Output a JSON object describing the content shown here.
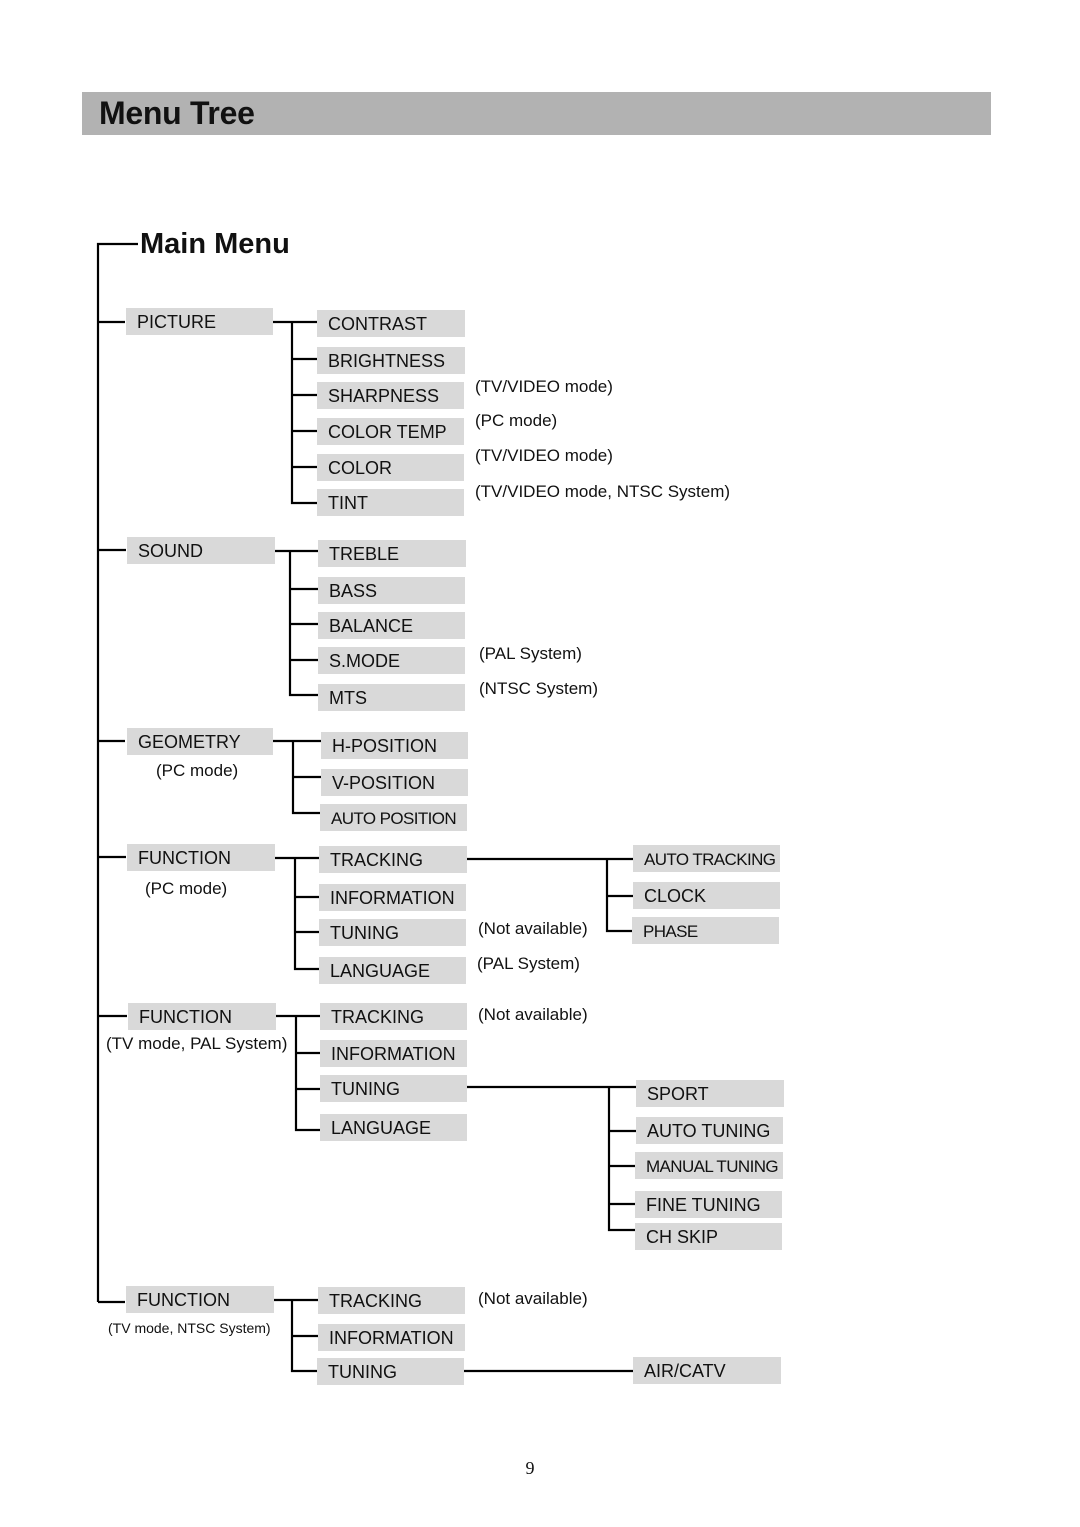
{
  "header": {
    "title": "Menu Tree"
  },
  "tree": {
    "title": "Main Menu",
    "groups": [
      {
        "label": "PICTURE",
        "note": "",
        "items": [
          {
            "label": "CONTRAST",
            "note": ""
          },
          {
            "label": "BRIGHTNESS",
            "note": ""
          },
          {
            "label": "SHARPNESS",
            "note": "(TV/VIDEO mode)"
          },
          {
            "label": "COLOR TEMP",
            "note": "(PC mode)"
          },
          {
            "label": "COLOR",
            "note": "(TV/VIDEO mode)"
          },
          {
            "label": "TINT",
            "note": "(TV/VIDEO mode, NTSC System)"
          }
        ]
      },
      {
        "label": "SOUND",
        "note": "",
        "items": [
          {
            "label": "TREBLE",
            "note": ""
          },
          {
            "label": "BASS",
            "note": ""
          },
          {
            "label": "BALANCE",
            "note": ""
          },
          {
            "label": "S.MODE",
            "note": "(PAL System)"
          },
          {
            "label": "MTS",
            "note": "(NTSC System)"
          }
        ]
      },
      {
        "label": "GEOMETRY",
        "note": "(PC mode)",
        "items": [
          {
            "label": "H-POSITION",
            "note": ""
          },
          {
            "label": "V-POSITION",
            "note": ""
          },
          {
            "label": "AUTO POSITION",
            "note": ""
          }
        ]
      },
      {
        "label": "FUNCTION",
        "note": "(PC mode)",
        "items": [
          {
            "label": "TRACKING",
            "note": "",
            "children": [
              "AUTO TRACKING",
              "CLOCK",
              "PHASE"
            ]
          },
          {
            "label": "INFORMATION",
            "note": ""
          },
          {
            "label": "TUNING",
            "note": "(Not available)"
          },
          {
            "label": "LANGUAGE",
            "note": "(PAL System)"
          }
        ]
      },
      {
        "label": "FUNCTION",
        "note": "(TV mode, PAL System)",
        "items": [
          {
            "label": "TRACKING",
            "note": "(Not available)"
          },
          {
            "label": "INFORMATION",
            "note": ""
          },
          {
            "label": "TUNING",
            "note": "",
            "children": [
              "SPORT",
              "AUTO TUNING",
              "MANUAL TUNING",
              "FINE TUNING",
              "CH SKIP"
            ]
          },
          {
            "label": "LANGUAGE",
            "note": ""
          }
        ]
      },
      {
        "label": "FUNCTION",
        "note": "(TV mode, NTSC System)",
        "items": [
          {
            "label": "TRACKING",
            "note": "(Not available)"
          },
          {
            "label": "INFORMATION",
            "note": ""
          },
          {
            "label": "TUNING",
            "note": "",
            "children": [
              "AIR/CATV"
            ]
          }
        ]
      }
    ]
  },
  "footer": {
    "page_number": "9"
  }
}
